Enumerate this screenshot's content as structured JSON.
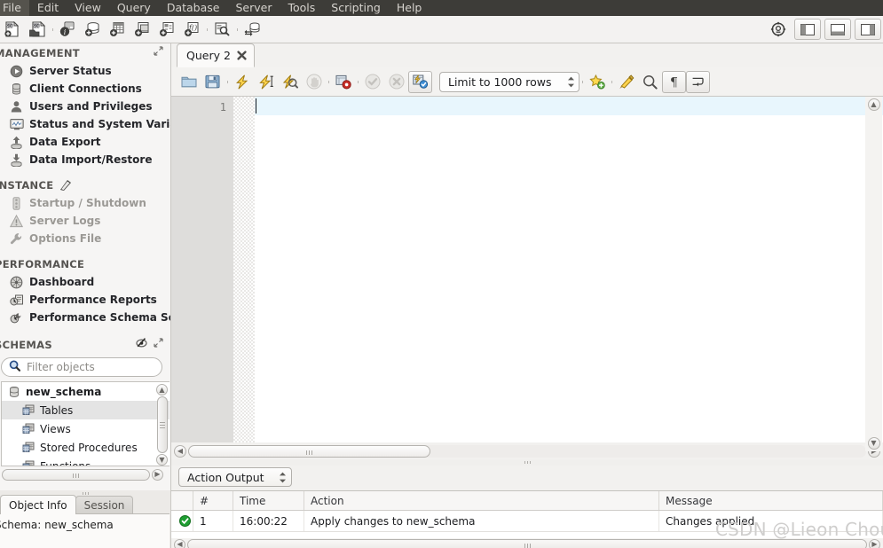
{
  "menubar": {
    "items": [
      "File",
      "Edit",
      "View",
      "Query",
      "Database",
      "Server",
      "Tools",
      "Scripting",
      "Help"
    ]
  },
  "main_toolbar": {
    "buttons": [
      {
        "name": "new-sql-tab-icon",
        "title": "New SQL Tab"
      },
      {
        "name": "open-sql-script-icon",
        "title": "Open SQL Script"
      },
      {
        "name": "server-info-icon",
        "title": "Server Info"
      },
      {
        "name": "create-schema-icon",
        "title": "Create Schema"
      },
      {
        "name": "create-table-icon",
        "title": "Create Table"
      },
      {
        "name": "create-view-icon",
        "title": "Create View"
      },
      {
        "name": "create-procedure-icon",
        "title": "Create Stored Procedure"
      },
      {
        "name": "create-function-icon",
        "title": "Create Function"
      },
      {
        "name": "inspect-schema-icon",
        "title": "Inspect Schema"
      },
      {
        "name": "reconnect-server-icon",
        "title": "Reconnect to Server"
      }
    ],
    "right_buttons": [
      {
        "name": "admin-target-icon"
      },
      {
        "name": "toggle-sidebar-icon"
      },
      {
        "name": "toggle-output-icon"
      },
      {
        "name": "toggle-secondary-sidebar-icon"
      }
    ]
  },
  "sidebar": {
    "sections": [
      {
        "title": "MANAGEMENT",
        "header_icons": [
          "expand-icon"
        ],
        "items": [
          {
            "label": "Server Status",
            "icon": "server-status-icon",
            "disabled": false
          },
          {
            "label": "Client Connections",
            "icon": "client-connections-icon",
            "disabled": false
          },
          {
            "label": "Users and Privileges",
            "icon": "users-privileges-icon",
            "disabled": false
          },
          {
            "label": "Status and System Variables",
            "icon": "status-variables-icon",
            "disabled": false
          },
          {
            "label": "Data Export",
            "icon": "data-export-icon",
            "disabled": false
          },
          {
            "label": "Data Import/Restore",
            "icon": "data-import-icon",
            "disabled": false
          }
        ]
      },
      {
        "title": "INSTANCE",
        "header_icons": [
          "instance-badge-icon"
        ],
        "items": [
          {
            "label": "Startup / Shutdown",
            "icon": "startup-shutdown-icon",
            "disabled": true
          },
          {
            "label": "Server Logs",
            "icon": "server-logs-icon",
            "disabled": true
          },
          {
            "label": "Options File",
            "icon": "options-file-icon",
            "disabled": true
          }
        ]
      },
      {
        "title": "PERFORMANCE",
        "header_icons": [],
        "items": [
          {
            "label": "Dashboard",
            "icon": "dashboard-icon",
            "disabled": false
          },
          {
            "label": "Performance Reports",
            "icon": "performance-reports-icon",
            "disabled": false
          },
          {
            "label": "Performance Schema Setup",
            "icon": "performance-schema-setup-icon",
            "disabled": false
          }
        ]
      }
    ],
    "schemas": {
      "title": "SCHEMAS",
      "header_icons": [
        "refresh-icon",
        "expand-icon"
      ],
      "filter_placeholder": "Filter objects",
      "filter_value": "",
      "tree": [
        {
          "label": "new_schema",
          "icon": "schema-icon",
          "level": 0,
          "selected": false
        },
        {
          "label": "Tables",
          "icon": "tables-icon",
          "level": 1,
          "selected": true
        },
        {
          "label": "Views",
          "icon": "views-icon",
          "level": 1,
          "selected": false
        },
        {
          "label": "Stored Procedures",
          "icon": "procedures-icon",
          "level": 1,
          "selected": false
        },
        {
          "label": "Functions",
          "icon": "functions-icon",
          "level": 1,
          "selected": false
        }
      ]
    }
  },
  "info_panel": {
    "tabs": [
      {
        "label": "Object Info",
        "active": true
      },
      {
        "label": "Session",
        "active": false
      }
    ],
    "content": "Schema: new_schema"
  },
  "editor": {
    "tabs": [
      {
        "label": "Query 2",
        "active": true,
        "close_icon": "close-icon"
      }
    ],
    "toolbar": {
      "buttons": [
        {
          "name": "open-script-icon"
        },
        {
          "name": "save-script-icon"
        },
        {
          "name": "execute-statement-icon"
        },
        {
          "name": "execute-current-statement-icon"
        },
        {
          "name": "explain-statement-icon"
        },
        {
          "name": "stop-execution-icon"
        },
        {
          "name": "toggle-stop-on-error-icon"
        },
        {
          "name": "commit-transaction-icon"
        },
        {
          "name": "rollback-transaction-icon"
        },
        {
          "name": "toggle-autocommit-icon"
        }
      ],
      "limit_label": "Limit to 1000 rows",
      "right_buttons": [
        {
          "name": "save-snippet-icon"
        },
        {
          "name": "beautify-query-icon"
        },
        {
          "name": "find-icon"
        },
        {
          "name": "toggle-invisible-chars-icon"
        },
        {
          "name": "toggle-word-wrap-icon"
        }
      ]
    },
    "line_numbers": [
      "1"
    ],
    "content": ""
  },
  "output": {
    "selector_label": "Action Output",
    "columns": [
      "",
      "#",
      "Time",
      "Action",
      "Message"
    ],
    "rows": [
      {
        "status": "success",
        "num": "1",
        "time": "16:00:22",
        "action": "Apply changes to new_schema",
        "message": "Changes applied"
      }
    ]
  },
  "watermark": "CSDN @Lieon Chou",
  "colors": {
    "menubar_bg": "#3d3c38",
    "toolbar_bg": "#f3f2f1",
    "sidebar_bg": "#f6f5f4",
    "active_line": "#e8f6fd",
    "selection": "#e4e4e4",
    "success_green": "#1e9e32"
  }
}
